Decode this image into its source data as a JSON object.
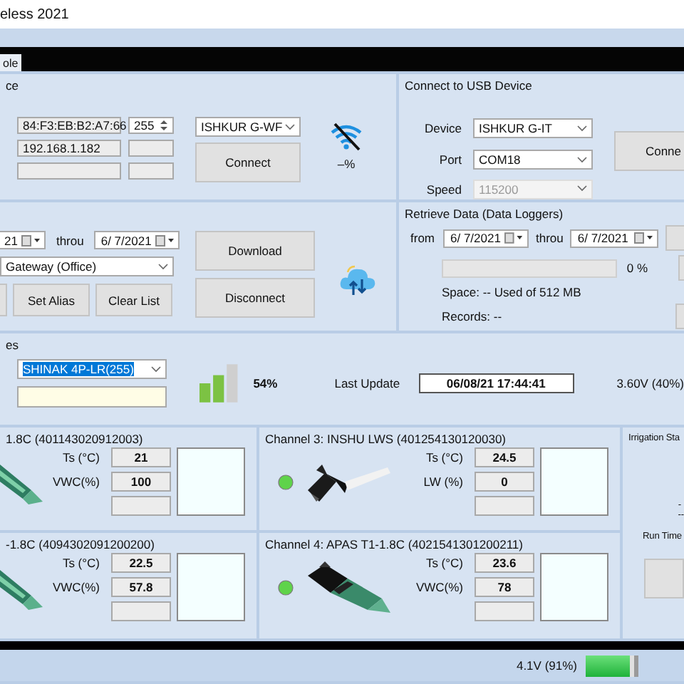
{
  "window": {
    "title": "eless 2021"
  },
  "tabs": [
    {
      "label": "ole",
      "selected": true
    }
  ],
  "wifi_panel": {
    "title": "ce",
    "mac": "84:F3:EB:B2:A7:66",
    "id_value": "255",
    "ip": "192.168.1.182",
    "device": "ISHKUR G-WF",
    "connect": "Connect",
    "signal": "–%"
  },
  "usb_panel": {
    "title": "Connect to USB Device",
    "connect": "Conne",
    "fields": [
      {
        "label": "Device",
        "value": "ISHKUR G-IT",
        "disabled": false
      },
      {
        "label": "Port",
        "value": "COM18",
        "disabled": false
      },
      {
        "label": "Speed",
        "value": "115200",
        "disabled": true
      }
    ]
  },
  "gateway_panel": {
    "from_date": "21",
    "through_label": "throu",
    "to_date": "6/ 7/2021",
    "gateway": "Gateway (Office)",
    "buttons": [
      "Set Alias",
      "Clear List"
    ],
    "download": "Download",
    "disconnect": "Disconnect"
  },
  "retrieve_panel": {
    "title": "Retrieve Data (Data Loggers)",
    "from_label": "from",
    "from_date": "6/ 7/2021",
    "through_label": "throu",
    "to_date": "6/ 7/2021",
    "progress": {
      "level": 0,
      "reading": "0 %"
    },
    "space": "Space: -- Used of 512 MB",
    "records": "Records: --"
  },
  "node_panel": {
    "title": "es",
    "node": "SHINAK 4P-LR(255)",
    "signal_reading": "54%",
    "last_update_label": "Last Update",
    "last_update": "06/08/21 17:44:41",
    "voltage": "3.60V (40%)"
  },
  "channels": [
    {
      "title": "1.8C (401143020912003)",
      "readings": [
        {
          "label": "Ts (°C)",
          "value": "21"
        },
        {
          "label": "VWC(%)",
          "value": "100"
        }
      ]
    },
    {
      "title": "Channel 3: INSHU LWS (401254130120030)",
      "led_on": true,
      "readings": [
        {
          "label": "Ts (°C)",
          "value": "24.5"
        },
        {
          "label": "LW (%)",
          "value": "0"
        }
      ]
    },
    {
      "title": "-1.8C (4094302091200200)",
      "readings": [
        {
          "label": "Ts (°C)",
          "value": "22.5"
        },
        {
          "label": "VWC(%)",
          "value": "57.8"
        }
      ]
    },
    {
      "title": "Channel 4: APAS T1-1.8C (4021541301200211)",
      "led_on": true,
      "readings": [
        {
          "label": "Ts (°C)",
          "value": "23.6"
        },
        {
          "label": "VWC(%)",
          "value": "78"
        }
      ]
    }
  ],
  "irrigation": {
    "title": "Irrigation Sta",
    "status": [
      "-",
      "--"
    ],
    "run_time_label": "Run Time"
  },
  "status_bar": {
    "battery": {
      "reading": "4.1V (91%)"
    }
  }
}
